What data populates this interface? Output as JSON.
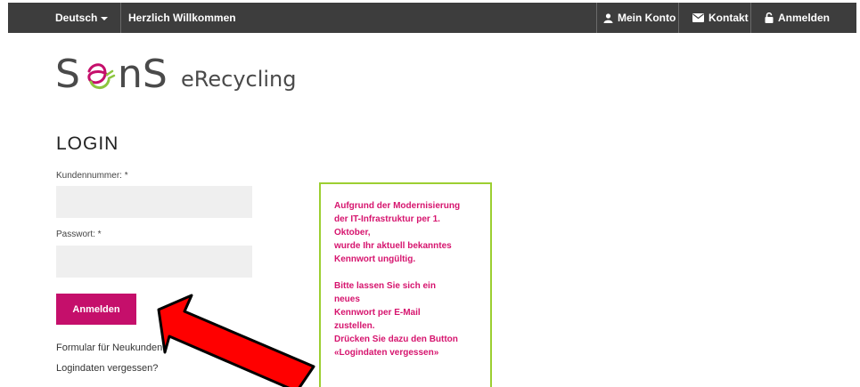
{
  "topbar": {
    "language": "Deutsch",
    "welcome": "Herzlich Willkommen",
    "account": "Mein Konto",
    "contact": "Kontakt",
    "login": "Anmelden"
  },
  "logo": {
    "brand": "SENS",
    "sub": "eRecycling"
  },
  "form": {
    "title": "LOGIN",
    "customer_label": "Kundennummer: *",
    "customer_value": "",
    "password_label": "Passwort: *",
    "password_value": "",
    "submit_label": "Anmelden",
    "register_link": "Formular für Neukunden",
    "forgot_link": "Logindaten vergessen?"
  },
  "notice": {
    "lines_1": [
      "Aufgrund der Modernisierung",
      "der IT-Infrastruktur per 1.",
      "Oktober,",
      "wurde Ihr aktuell bekanntes",
      "Kennwort ungültig."
    ],
    "lines_2": [
      "Bitte lassen Sie sich ein",
      "neues",
      "Kennwort per E-Mail",
      "zustellen.",
      "Drücken Sie dazu den Button",
      "«Logindaten vergessen»"
    ]
  },
  "colors": {
    "topbar": "#3d3d3d",
    "brand_pink": "#c50f6b",
    "notice_text": "#d6146e",
    "notice_border": "#9ccf31",
    "logo_green": "#8cc63f",
    "arrow_red": "#ff0000"
  }
}
